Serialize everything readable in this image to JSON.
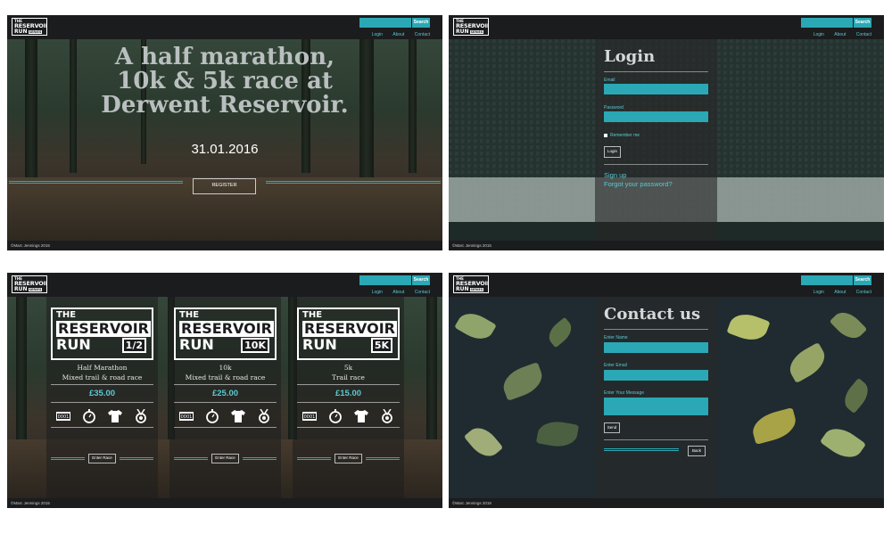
{
  "header": {
    "logo": {
      "l1": "THE",
      "l2": "RESERVOIR",
      "l3": "RUN",
      "l4": "SERIES"
    },
    "search_label": "Search",
    "nav": [
      "Login",
      "About",
      "Contact"
    ],
    "footer": "©Marc Jennings 2015"
  },
  "home": {
    "title_lines": [
      "A half marathon,",
      "10k & 5k race at",
      "Derwent Reservoir."
    ],
    "date": "31.01.2016",
    "register_label": "REGISTER"
  },
  "login": {
    "title": "Login",
    "email_label": "Email",
    "password_label": "Password",
    "remember_label": "Remember me",
    "login_button": "Login",
    "signup_link": "Sign up",
    "forgot_link": "Forgot your password?"
  },
  "races": {
    "cards": [
      {
        "logo_the": "THE",
        "logo_reservoir": "RESERVOIR",
        "logo_run": "RUN",
        "badge": "1/2",
        "name": "Half Marathon",
        "subtitle": "Mixed trail & road race",
        "price": "£35.00",
        "button": "Enter Race"
      },
      {
        "logo_the": "THE",
        "logo_reservoir": "RESERVOIR",
        "logo_run": "RUN",
        "badge": "10K",
        "name": "10k",
        "subtitle": "Mixed trail & road race",
        "price": "£25.00",
        "button": "Enter Race"
      },
      {
        "logo_the": "THE",
        "logo_reservoir": "RESERVOIR",
        "logo_run": "RUN",
        "badge": "5K",
        "name": "5k",
        "subtitle": "Trail race",
        "price": "£15.00",
        "button": "Enter Race"
      }
    ],
    "bib_number": "0001",
    "icons": [
      "race-bib-icon",
      "stopwatch-icon",
      "tshirt-icon",
      "medal-icon"
    ]
  },
  "contact": {
    "title": "Contact us",
    "name_label": "Enter Name",
    "email_label": "Enter Email",
    "message_label": "Enter Your Message",
    "send_button": "Send",
    "back_button": "Back"
  },
  "colors": {
    "accent": "#2ba8b5",
    "dark": "#1b1c1e",
    "link": "#5bc8d2"
  }
}
